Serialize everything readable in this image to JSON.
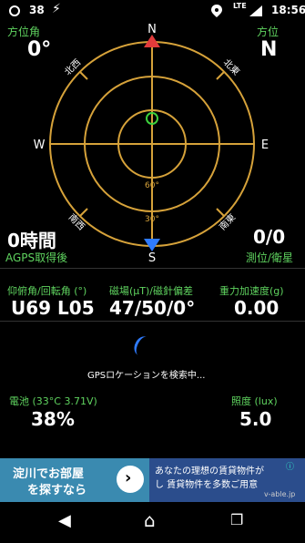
{
  "status_bar": {
    "notification_count": "38",
    "network": "LTE",
    "time": "18:56"
  },
  "left_top": {
    "label": "方位角",
    "value": "0°"
  },
  "right_top": {
    "label": "方位",
    "value": "N"
  },
  "compass": {
    "cardinals": {
      "n": "N",
      "e": "E",
      "s": "S",
      "w": "W"
    },
    "intercardinals": {
      "nw": "北西",
      "ne": "北東",
      "sw": "南西",
      "se": "南東"
    },
    "ring_labels": [
      "60°",
      "30°"
    ]
  },
  "left_bottom": {
    "value": "0時間",
    "label": "AGPS取得後"
  },
  "right_bottom": {
    "value": "0/0",
    "label": "測位/衛星"
  },
  "metrics": [
    {
      "label": "仰俯角/回転角 (°)",
      "value": "U69 L05"
    },
    {
      "label": "磁場(μT)/磁針偏差",
      "value": "47/50/0°"
    },
    {
      "label": "重力加速度(g)",
      "value": "0.00"
    }
  ],
  "gps_status": "GPSロケーションを検索中...",
  "battery": {
    "label": "電池 (33°C 3.71V)",
    "value": "38%"
  },
  "illuminance": {
    "label": "照度 (lux)",
    "value": "5.0"
  },
  "ad": {
    "left_text_1": "淀川でお部屋",
    "left_text_2": "を探すなら",
    "right_text_1": "あなたの理想の賃貸物件が",
    "right_text_2": "し 賃貸物件を多数ご用意",
    "source": "v-able.jp"
  }
}
